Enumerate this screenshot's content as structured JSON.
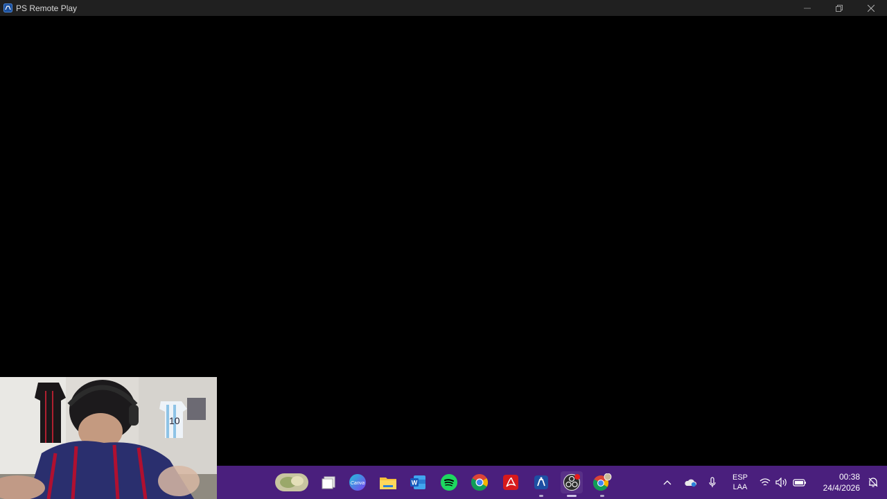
{
  "window": {
    "title": "PS Remote Play",
    "icon": "ps-remote-play-icon"
  },
  "window_controls": [
    "minimize-icon",
    "restore-icon",
    "close-icon"
  ],
  "taskbar": {
    "background": "#4a1f7d",
    "apps": [
      {
        "name": "widgets",
        "icon": "weather-widget-icon"
      },
      {
        "name": "file-stack",
        "icon": "window-icon"
      },
      {
        "name": "Canva",
        "icon": "canva-icon",
        "label": "Canva"
      },
      {
        "name": "File Explorer",
        "icon": "folder-icon"
      },
      {
        "name": "Word",
        "icon": "word-icon"
      },
      {
        "name": "Spotify",
        "icon": "spotify-icon"
      },
      {
        "name": "Chrome",
        "icon": "chrome-icon"
      },
      {
        "name": "Acrobat",
        "icon": "acrobat-icon"
      },
      {
        "name": "PS Remote Play",
        "icon": "ps-remote-play-icon"
      },
      {
        "name": "OBS Studio",
        "icon": "obs-icon"
      },
      {
        "name": "Chrome Profile",
        "icon": "chrome-profile-icon"
      }
    ],
    "tray": {
      "lang_line1": "ESP",
      "lang_line2": "LAA",
      "time": "00:38",
      "date": "24/4/2026"
    }
  },
  "webcam": {
    "jersey_number": "10"
  }
}
